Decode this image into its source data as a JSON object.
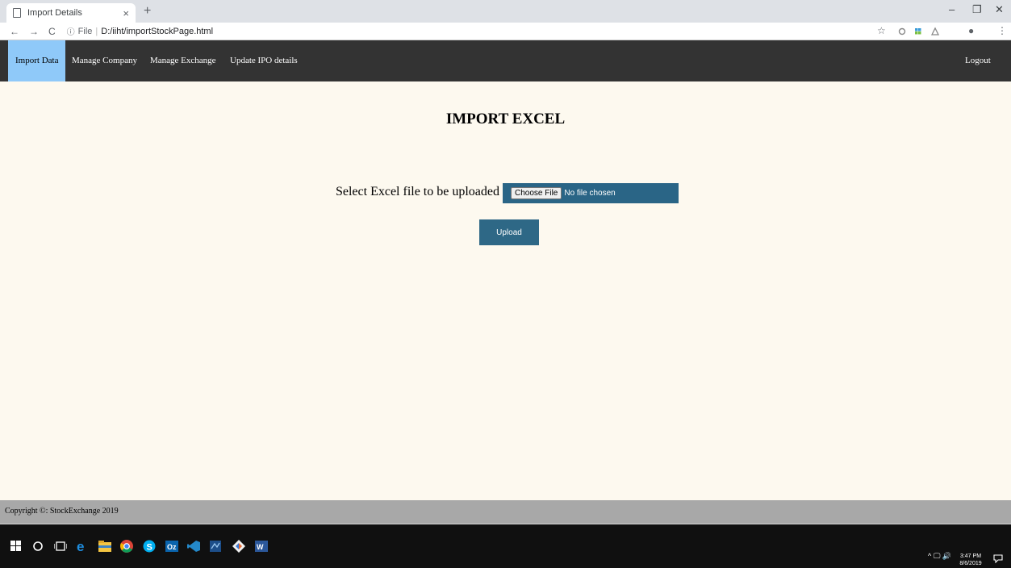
{
  "browser": {
    "tab_title": "Import Details",
    "tab_close": "×",
    "new_tab": "+",
    "url_info": "ⓘ",
    "url_scheme": "File",
    "url_sep": "|",
    "url_path": "D:/iiht/importStockPage.html",
    "nav_back": "←",
    "nav_forward": "→",
    "nav_reload": "C",
    "win_minimize": "–",
    "win_restore": "❐",
    "win_close": "✕",
    "bookmark_star": "☆",
    "menu_dots": "⋮",
    "profile": "●"
  },
  "nav": {
    "items": [
      "Import Data",
      "Manage Company",
      "Manage Exchange",
      "Update IPO details"
    ],
    "logout": "Logout"
  },
  "main": {
    "heading": "IMPORT EXCEL",
    "file_label": "Select Excel file to be uploaded",
    "choose_file": "Choose File",
    "no_file": "No file chosen",
    "upload": "Upload"
  },
  "footer": {
    "copyright": "Copyright ©: StockExchange 2019"
  },
  "taskbar": {
    "time": "3:47 PM",
    "date": "8/6/2019",
    "tray_icons": "^ 🖵 🔊"
  },
  "colors": {
    "nav_bg": "#333333",
    "nav_active": "#8fc9f9",
    "content_bg": "#fdf9ef",
    "button": "#2e6886",
    "footer_bg": "#a8a8a8"
  }
}
